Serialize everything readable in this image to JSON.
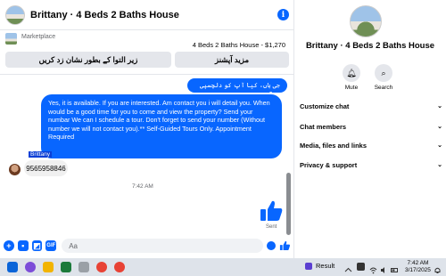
{
  "header": {
    "title": "Brittany · 4 Beds 2 Baths House"
  },
  "marketplace": {
    "label": "Marketplace",
    "item": "4 Beds 2 Baths House - $1,270",
    "btn_left": "زیر التوا کے بطور نشان زد کریں",
    "btn_right": "مزید آپشنز"
  },
  "messages": {
    "out1": "جی ہاں، کیا آپ کو دلچسپی ہے؟",
    "out2": "Yes, it is available. If you are interested.  Am contact you i will detail you. When would be a good time for you to come and view the property? Send your numbar We can I schedule a tour.  Don't forget to send your number (Without number we will not contact you).** Self-Guided Tours Only. Appointment Required",
    "sender": "Brittany",
    "in1": "9565958846",
    "time": "7:42 AM",
    "sent": "Sent"
  },
  "composer": {
    "placeholder": "Aa"
  },
  "side": {
    "title": "Brittany · 4 Beds 2 Baths House",
    "mute": "Mute",
    "search": "Search",
    "menu": [
      "Customize chat",
      "Chat members",
      "Media, files and links",
      "Privacy & support"
    ]
  },
  "taskbar": {
    "result": "Result",
    "time": "7:42 AM",
    "date": "3/17/2025"
  },
  "colors": {
    "accent": "#0866ff",
    "bubble_in": "#f0f0f0"
  }
}
